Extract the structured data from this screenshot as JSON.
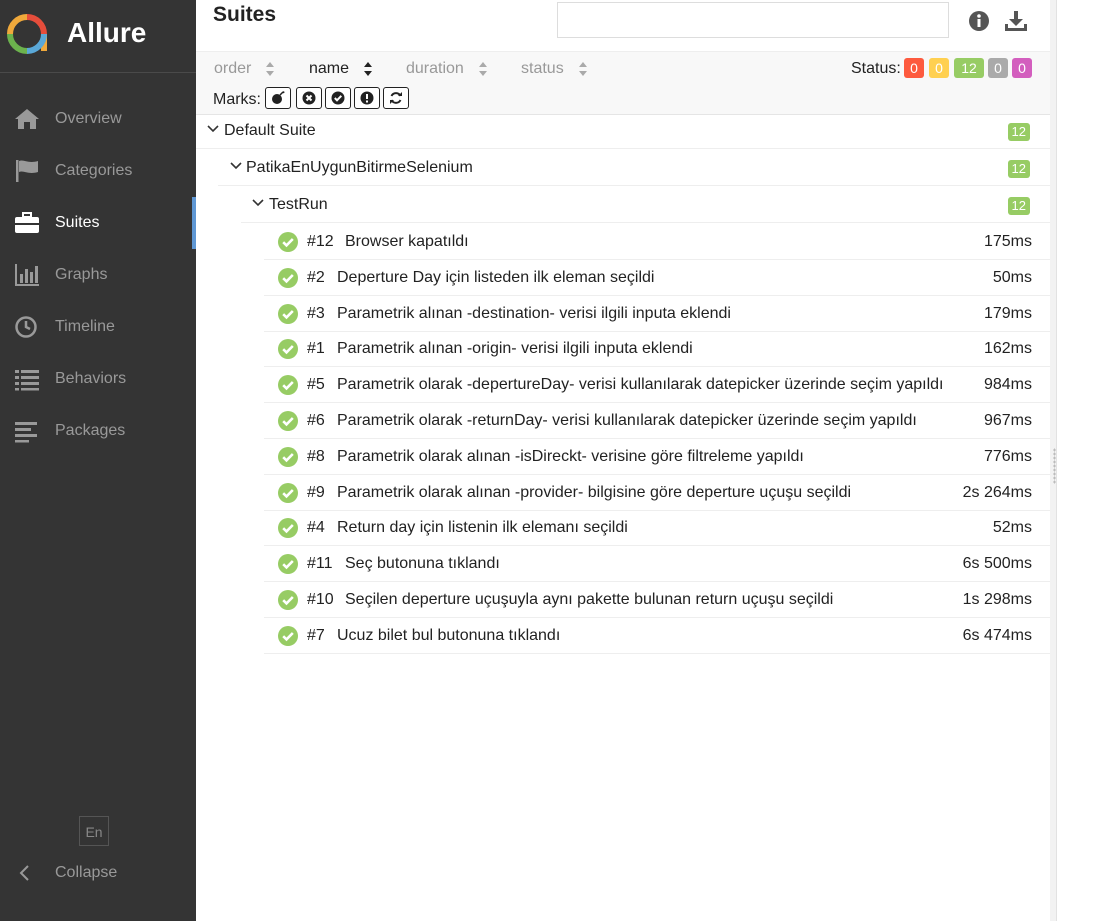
{
  "app": {
    "name": "Allure"
  },
  "sidebar": {
    "items": [
      {
        "label": "Overview",
        "icon": "home-icon"
      },
      {
        "label": "Categories",
        "icon": "flag-icon"
      },
      {
        "label": "Suites",
        "icon": "briefcase-icon",
        "active": true
      },
      {
        "label": "Graphs",
        "icon": "bar-chart-icon"
      },
      {
        "label": "Timeline",
        "icon": "clock-icon"
      },
      {
        "label": "Behaviors",
        "icon": "list-icon"
      },
      {
        "label": "Packages",
        "icon": "align-left-icon"
      }
    ],
    "language": "En",
    "collapse_label": "Collapse"
  },
  "pane": {
    "title": "Suites",
    "search_placeholder": "",
    "sorters": [
      "order",
      "name",
      "duration",
      "status"
    ],
    "status_label": "Status:",
    "status_badges": [
      {
        "value": "0",
        "color": "#fd5a3e"
      },
      {
        "value": "0",
        "color": "#ffd050"
      },
      {
        "value": "12",
        "color": "#97cc64"
      },
      {
        "value": "0",
        "color": "#aaaaaa"
      },
      {
        "value": "0",
        "color": "#d35ebe"
      }
    ],
    "marks_label": "Marks:"
  },
  "tree": {
    "suite": {
      "name": "Default Suite",
      "count": "12"
    },
    "package": {
      "name": "PatikaEnUygunBitirmeSelenium",
      "count": "12"
    },
    "class": {
      "name": "TestRun",
      "count": "12"
    },
    "tests": [
      {
        "order": "#12",
        "name": "Browser kapatıldı",
        "duration": "175ms"
      },
      {
        "order": "#2",
        "name": "Deperture Day için listeden ilk eleman seçildi",
        "duration": "50ms"
      },
      {
        "order": "#3",
        "name": "Parametrik alınan -destination- verisi ilgili inputa eklendi",
        "duration": "179ms"
      },
      {
        "order": "#1",
        "name": "Parametrik alınan -origin- verisi ilgili inputa eklendi",
        "duration": "162ms"
      },
      {
        "order": "#5",
        "name": "Parametrik olarak -depertureDay- verisi kullanılarak datepicker üzerinde seçim yapıldı",
        "duration": "984ms"
      },
      {
        "order": "#6",
        "name": "Parametrik olarak -returnDay- verisi kullanılarak datepicker üzerinde seçim yapıldı",
        "duration": "967ms"
      },
      {
        "order": "#8",
        "name": "Parametrik olarak alınan -isDireckt- verisine göre filtreleme yapıldı",
        "duration": "776ms"
      },
      {
        "order": "#9",
        "name": "Parametrik olarak alınan -provider- bilgisine göre deperture uçuşu seçildi",
        "duration": "2s 264ms"
      },
      {
        "order": "#4",
        "name": "Return day için listenin ilk elemanı seçildi",
        "duration": "52ms"
      },
      {
        "order": "#11",
        "name": "Seç butonuna tıklandı",
        "duration": "6s 500ms"
      },
      {
        "order": "#10",
        "name": "Seçilen deperture uçuşuyla aynı pakette bulunan return uçuşu seçildi",
        "duration": "1s 298ms"
      },
      {
        "order": "#7",
        "name": "Ucuz bilet bul butonuna tıklandı",
        "duration": "6s 474ms"
      }
    ]
  }
}
